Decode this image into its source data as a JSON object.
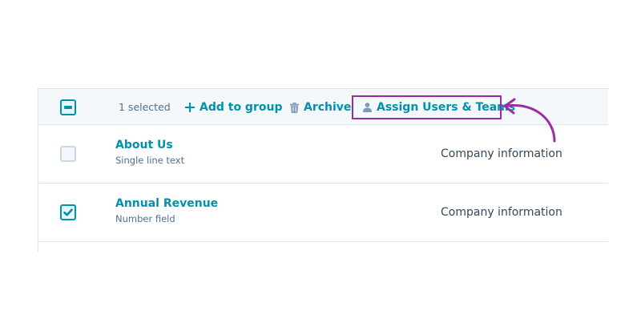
{
  "toolbar": {
    "selected_text": "1 selected",
    "add_to_group_label": "Add to group",
    "archive_label": "Archive",
    "assign_label": "Assign Users & Teams",
    "header_checkbox_state": "indeterminate"
  },
  "rows": [
    {
      "name": "About Us",
      "field_type": "Single line text",
      "group": "Company information",
      "checked": false
    },
    {
      "name": "Annual Revenue",
      "field_type": "Number field",
      "group": "Company information",
      "checked": true
    }
  ],
  "colors": {
    "accent": "#0091ae",
    "highlight": "#9b2ca6",
    "text": "#33475b",
    "muted": "#516f90",
    "border": "#dfe3eb",
    "toolbar_bg": "#f5f8fa"
  },
  "icons": {
    "add": "plus-icon",
    "archive": "trash-icon",
    "assign": "user-icon",
    "annotation": "curved-arrow-icon"
  }
}
